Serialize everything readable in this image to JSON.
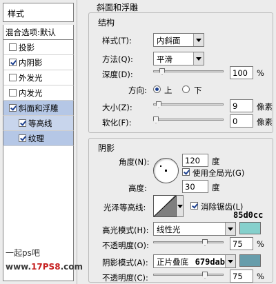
{
  "left_panel": {
    "styles_header": "样式",
    "blend_options": "混合选项:默认",
    "items": [
      {
        "label": "投影",
        "checked": false
      },
      {
        "label": "内阴影",
        "checked": true
      },
      {
        "label": "外发光",
        "checked": false
      },
      {
        "label": "内发光",
        "checked": false
      },
      {
        "label": "斜面和浮雕",
        "checked": true
      },
      {
        "label": "等高线",
        "checked": true
      },
      {
        "label": "纹理",
        "checked": true
      }
    ],
    "watermark_line1": "一起ps吧",
    "watermark_line2_a": "www.",
    "watermark_line2_b": "17PS8",
    "watermark_line2_c": ".com"
  },
  "bevel": {
    "panel_title": "斜面和浮雕",
    "structure": {
      "title": "结构",
      "style_label": "样式(T):",
      "style_value": "内斜面",
      "method_label": "方法(Q):",
      "method_value": "平滑",
      "depth_label": "深度(D):",
      "depth_value": "100",
      "depth_unit": "%",
      "depth_level": 0.1,
      "direction_label": "方向:",
      "direction_up": "上",
      "direction_down": "下",
      "direction_selected": "上",
      "size_label": "大小(Z):",
      "size_value": "9",
      "size_unit": "像素",
      "soften_label": "软化(F):",
      "soften_value": "0",
      "soften_unit": "像素"
    },
    "shading": {
      "title": "阴影",
      "angle_label": "角度(N):",
      "angle_value": "120",
      "angle_unit": "度",
      "global_light_label": "使用全局光(G)",
      "global_light_checked": true,
      "altitude_label": "高度:",
      "altitude_value": "30",
      "altitude_unit": "度",
      "gloss_contour_label": "光泽等高线:",
      "anti_alias_label": "消除锯齿(L)",
      "anti_alias_checked": true,
      "highlight_mode_label": "高光模式(H):",
      "highlight_mode_value": "线性光",
      "highlight_color_hex": "85d0cc",
      "highlight_color": "#85d0cc",
      "highlight_opacity_label": "不透明度(O):",
      "highlight_opacity_value": "75",
      "highlight_opacity_unit": "%",
      "shadow_mode_label": "阴影模式(A):",
      "shadow_mode_value": "正片叠底",
      "shadow_color_hex": "679dab",
      "shadow_color": "#679dab",
      "shadow_opacity_label": "不透明度(C):",
      "shadow_opacity_value": "75",
      "shadow_opacity_unit": "%"
    }
  }
}
